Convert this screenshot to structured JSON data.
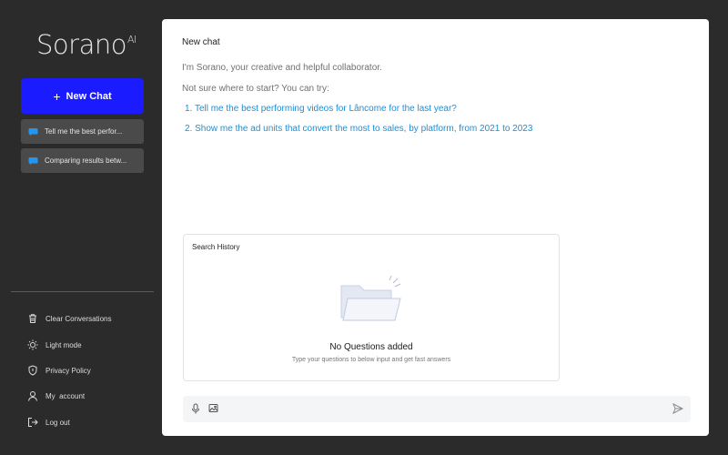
{
  "sidebar": {
    "logo": "Sorano",
    "logo_sup": "AI",
    "new_chat_icon": "+",
    "new_chat_label": "New Chat",
    "history": [
      {
        "label": "Tell me the best perfor...",
        "icon": "chat-bubble-icon"
      },
      {
        "label": "Comparing results betw...",
        "icon": "chat-bubble-icon"
      }
    ],
    "menu": [
      {
        "label": "Clear Conversations",
        "icon": "trash-icon"
      },
      {
        "label": "Light mode",
        "icon": "sun-icon"
      },
      {
        "label": "Privacy Policy",
        "icon": "shield-icon"
      },
      {
        "label": "My  account",
        "icon": "user-icon"
      },
      {
        "label": "Log out",
        "icon": "logout-icon"
      }
    ]
  },
  "main": {
    "title": "New chat",
    "intro_1": "I'm Sorano, your creative and helpful collaborator.",
    "intro_2": "Not sure where to start? You can try:",
    "suggestions": [
      "1.  Tell me the best performing videos for Lâncome for the last year?",
      "2.  Show me the ad units that convert the most to sales, by platform, from 2021 to 2023"
    ],
    "search_history": {
      "title": "Search History",
      "empty_icon": "empty-folder-icon",
      "empty_title": "No Questions added",
      "empty_subtitle": "Type your questions to below input and get fast answers"
    },
    "input": {
      "placeholder": "",
      "icons": [
        "microphone-icon",
        "image-icon",
        "send-icon"
      ]
    }
  },
  "colors": {
    "background": "#2b2b2b",
    "accent": "#1b1bff",
    "link": "#1a8fd8",
    "chat_icon": "#2196f3"
  }
}
